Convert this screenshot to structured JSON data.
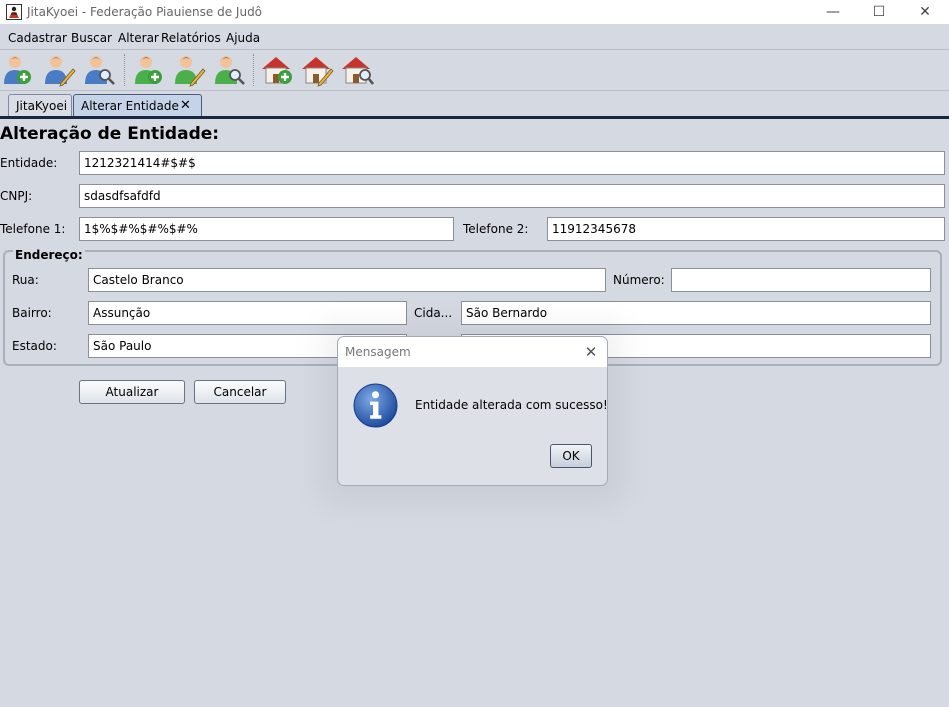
{
  "window": {
    "title": "JitaKyoei - Federação Piauiense de Judô",
    "minimize": "—",
    "maximize": "☐",
    "close": "✕"
  },
  "menu": [
    "Cadastrar",
    "Buscar",
    "Alterar",
    "Relatórios",
    "Ajuda"
  ],
  "toolbar": {
    "icons": [
      "add-user-icon",
      "edit-user-icon",
      "search-user-icon",
      "add-athlete-icon",
      "edit-athlete-icon",
      "search-athlete-icon",
      "add-entity-icon",
      "edit-entity-icon",
      "search-entity-icon"
    ]
  },
  "tabs": [
    {
      "label": "JitaKyoei"
    },
    {
      "label": "Alterar Entidade",
      "close": "✕"
    }
  ],
  "form": {
    "heading": "Alteração de Entidade:",
    "entidade_label": "Entidade:",
    "entidade_value": "1212321414#$#$",
    "cnpj_label": "CNPJ:",
    "cnpj_value": "sdasdfsafdfd",
    "telefone1_label": "Telefone 1:",
    "telefone1_value": "1$%$#%$#%$#%",
    "telefone2_label": "Telefone 2:",
    "telefone2_value": "11912345678",
    "endereco_legend": "Endereço:",
    "rua_label": "Rua:",
    "rua_value": "Castelo Branco",
    "numero_label": "Número:",
    "numero_value": "",
    "bairro_label": "Bairro:",
    "bairro_value": "Assunção",
    "cidade_label": "Cida...",
    "cidade_value": "São Bernardo",
    "estado_label": "Estado:",
    "estado_value": "São Paulo",
    "extra_value": "",
    "atualizar": "Atualizar",
    "cancelar": "Cancelar"
  },
  "dialog": {
    "title": "Mensagem",
    "close": "✕",
    "message": "Entidade alterada com sucesso!",
    "ok": "OK"
  },
  "colors": {
    "background": "#d5d9e2",
    "tab_rule": "#1a2740",
    "info_icon": "#2f5fb0"
  }
}
